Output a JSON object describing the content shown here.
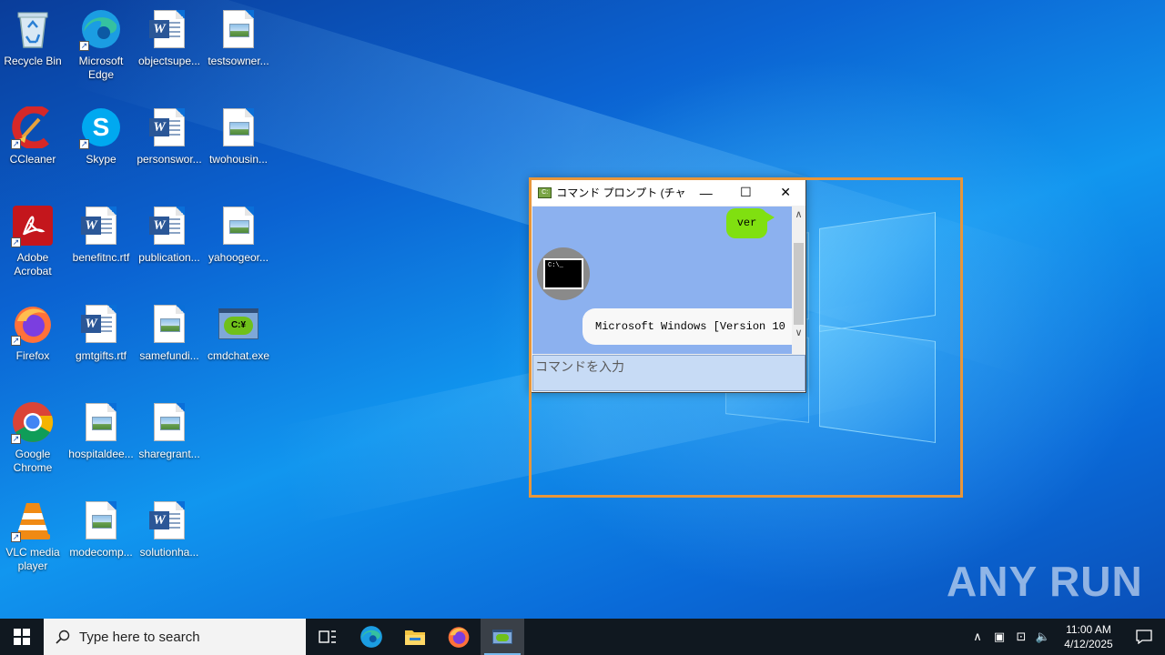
{
  "desktop": {
    "icons": [
      {
        "name": "recycle-bin",
        "label": "Recycle Bin",
        "icon": "recycle-bin-icon"
      },
      {
        "name": "ccleaner",
        "label": "CCleaner",
        "icon": "ccleaner-icon"
      },
      {
        "name": "adobe-acrobat",
        "label": "Adobe Acrobat",
        "icon": "acrobat-icon"
      },
      {
        "name": "firefox",
        "label": "Firefox",
        "icon": "firefox-icon"
      },
      {
        "name": "google-chrome",
        "label": "Google Chrome",
        "icon": "chrome-icon"
      },
      {
        "name": "vlc",
        "label": "VLC media player",
        "icon": "vlc-icon"
      },
      {
        "name": "edge",
        "label": "Microsoft Edge",
        "icon": "edge-icon"
      },
      {
        "name": "skype",
        "label": "Skype",
        "icon": "skype-icon"
      },
      {
        "name": "benefitnc",
        "label": "benefitnc.rtf",
        "icon": "word-doc-icon"
      },
      {
        "name": "gmtgifts",
        "label": "gmtgifts.rtf",
        "icon": "word-doc-icon"
      },
      {
        "name": "hospitaldee",
        "label": "hospitaldee...",
        "icon": "image-file-icon"
      },
      {
        "name": "modecomp",
        "label": "modecomp...",
        "icon": "image-file-icon"
      },
      {
        "name": "objectsupe",
        "label": "objectsupe...",
        "icon": "word-doc-icon"
      },
      {
        "name": "personswor",
        "label": "personswor...",
        "icon": "word-doc-icon"
      },
      {
        "name": "publication",
        "label": "publication...",
        "icon": "word-doc-icon"
      },
      {
        "name": "samefundi",
        "label": "samefundi...",
        "icon": "image-file-icon"
      },
      {
        "name": "sharegrant",
        "label": "sharegrant...",
        "icon": "image-file-icon"
      },
      {
        "name": "solutionha",
        "label": "solutionha...",
        "icon": "word-doc-icon"
      },
      {
        "name": "testsowner",
        "label": "testsowner...",
        "icon": "image-file-icon"
      },
      {
        "name": "twohousin",
        "label": "twohousin...",
        "icon": "image-file-icon"
      },
      {
        "name": "yahoogeor",
        "label": "yahoogeor...",
        "icon": "image-file-icon"
      },
      {
        "name": "cmdchat",
        "label": "cmdchat.exe",
        "icon": "cmdchat-icon"
      }
    ]
  },
  "window": {
    "title": "コマンド プロンプト (チャット...",
    "minimize": "—",
    "maximize": "☐",
    "close": "✕",
    "user_message": "ver",
    "bot_avatar_text": "C:\\_",
    "bot_message": "Microsoft Windows [Version 10",
    "input_placeholder": "コマンドを入力",
    "scroll_up": "∧",
    "scroll_down": "∨"
  },
  "cmdchat_icon_text": "C:¥",
  "watermark": "ANY RUN",
  "taskbar": {
    "search_placeholder": "Type here to search",
    "clock_time": "11:00 AM",
    "clock_date": "4/12/2025"
  },
  "colors": {
    "highlight": "#e8963a",
    "user_bubble": "#80e010",
    "chat_bg": "#8cb1ef"
  }
}
